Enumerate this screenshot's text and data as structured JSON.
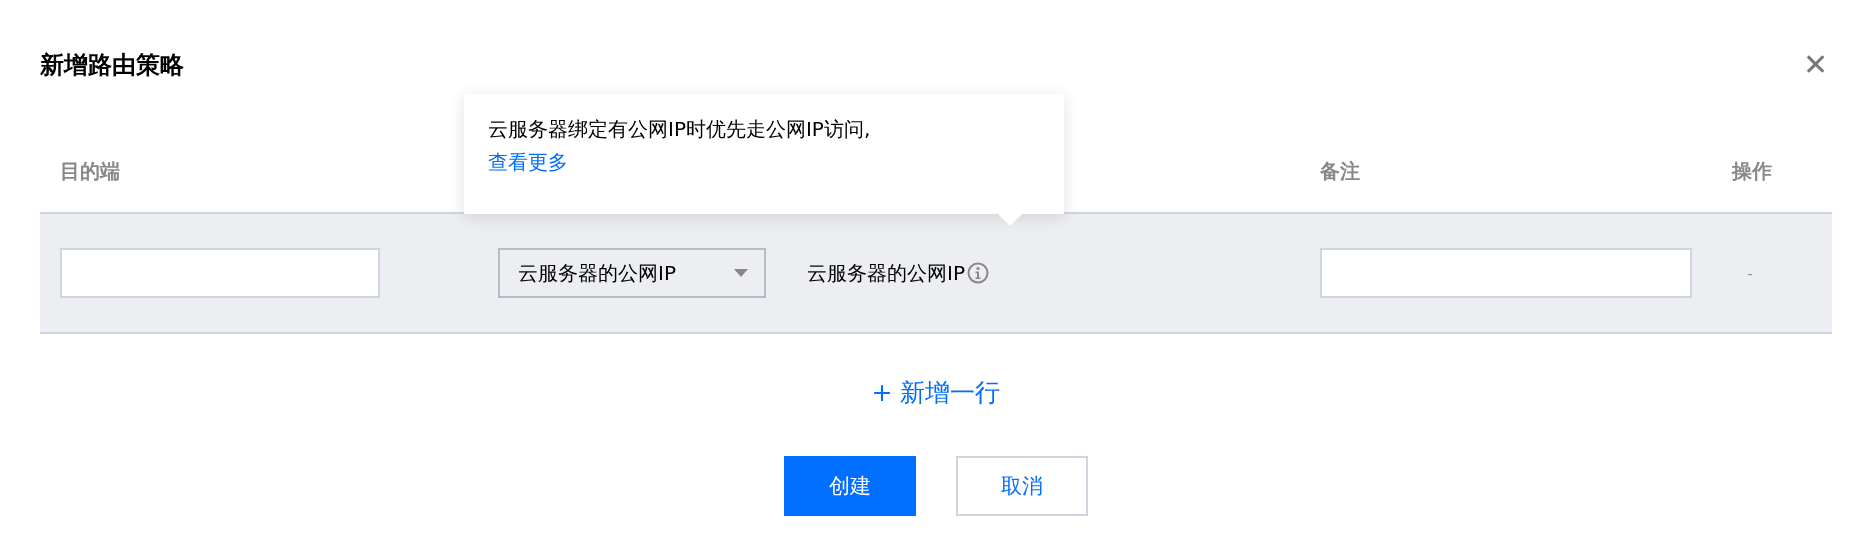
{
  "dialog": {
    "title": "新增路由策略",
    "close": "✕"
  },
  "table": {
    "columns": [
      {
        "label": "目的端",
        "kind": "destination"
      },
      {
        "label": "备注",
        "kind": "remark"
      },
      {
        "label": "操作",
        "kind": "action"
      }
    ],
    "rows": [
      {
        "destination": {
          "kind": "input"
        },
        "next_hop_type": {
          "value": "云服务器的公网IP"
        },
        "next_hop": "云服务器的公网IP",
        "remark": {
          "kind": "input"
        },
        "action": "-"
      }
    ]
  },
  "tooltip": {
    "text": "云服务器绑定有公网IP时优先走公网IP访问,",
    "link": "查看更多"
  },
  "add_row": {
    "icon": "+",
    "label": "新增一行"
  },
  "buttons": [
    {
      "label": "创建",
      "kind": "primary"
    },
    {
      "label": "取消",
      "kind": "secondary"
    }
  ]
}
